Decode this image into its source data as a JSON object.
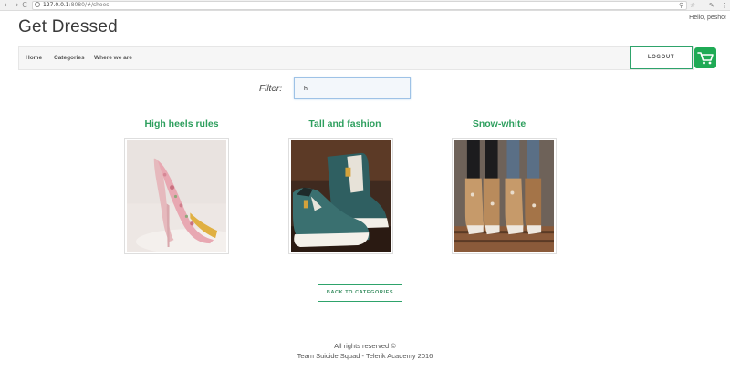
{
  "browser": {
    "url_host": "127.0.0.1",
    "url_rest": ":8080/#/shoes",
    "back_glyph": "←",
    "forward_glyph": "→",
    "reload_glyph": "C"
  },
  "header": {
    "greeting": "Hello, pesho!",
    "logo": "Get Dressed"
  },
  "nav": {
    "items": [
      {
        "label": "Home"
      },
      {
        "label": "Categories"
      },
      {
        "label": "Where we are"
      }
    ],
    "logout_label": "LOGOUT"
  },
  "filter": {
    "label": "Filter:",
    "value": "hi"
  },
  "products": [
    {
      "title": "High heels rules"
    },
    {
      "title": "Tall and fashion"
    },
    {
      "title": "Snow-white"
    }
  ],
  "back_button": "BACK TO CATEGORIES",
  "footer": {
    "line1": "All rights reserved ©",
    "line2": "Team Suicide Squad - Telerik Academy 2016"
  },
  "colors": {
    "accent": "#2e9f5e",
    "cart": "#1faa55"
  }
}
